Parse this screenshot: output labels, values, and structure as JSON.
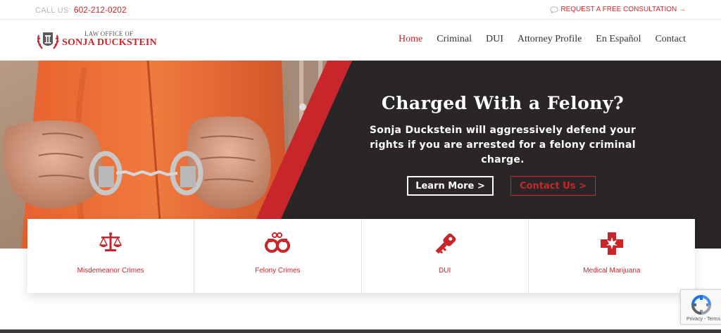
{
  "topbar": {
    "call_label": "CALL US:",
    "phone": "602-212-0202",
    "consult_label": "REQUEST A FREE CONSULTATION →"
  },
  "logo": {
    "line1": "LAW OFFICE OF",
    "line2": "SONJA DUCKSTEIN"
  },
  "nav": {
    "items": [
      "Home",
      "Criminal",
      "DUI",
      "Attorney Profile",
      "En Español",
      "Contact"
    ],
    "active": "Home"
  },
  "hero": {
    "title": "Charged With a Felony?",
    "subtitle": "Sonja Duckstein will aggressively defend your rights if you are arrested for a felony criminal charge.",
    "learn_more": "Learn More >",
    "contact_us": "Contact Us >"
  },
  "practice_areas": [
    {
      "label": "Misdemeanor Crimes",
      "icon": "scales-icon"
    },
    {
      "label": "Felony Crimes",
      "icon": "handcuffs-icon"
    },
    {
      "label": "DUI",
      "icon": "car-key-icon"
    },
    {
      "label": "Medical Marijuana",
      "icon": "medical-cross-icon"
    }
  ],
  "recaptcha": {
    "text": "Privacy - Terms"
  },
  "colors": {
    "accent": "#c8262b",
    "dark": "#2a2627",
    "jumpsuit": "#e8622f"
  }
}
